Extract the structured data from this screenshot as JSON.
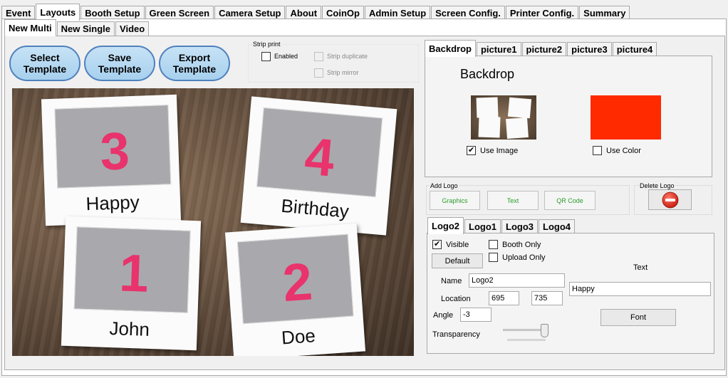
{
  "main_tabs": [
    "Event",
    "Layouts",
    "Booth Setup",
    "Green Screen",
    "Camera Setup",
    "About",
    "CoinOp",
    "Admin Setup",
    "Screen Config.",
    "Printer Config.",
    "Summary"
  ],
  "sub_tabs": [
    "New Multi",
    "New Single",
    "Video"
  ],
  "toolbar": {
    "select_template": "Select\nTemplate",
    "save_template": "Save\nTemplate",
    "export_template": "Export\nTemplate"
  },
  "strip_print": {
    "title": "Strip print",
    "enabled": "Enabled",
    "strip_duplicate": "Strip duplicate",
    "strip_mirror": "Strip mirror"
  },
  "template_preview": {
    "cards": [
      {
        "number": "3",
        "caption": "Happy"
      },
      {
        "number": "4",
        "caption": "Birthday"
      },
      {
        "number": "1",
        "caption": "John"
      },
      {
        "number": "2",
        "caption": "Doe"
      }
    ]
  },
  "backdrop_tabs": [
    "Backdrop",
    "picture1",
    "picture2",
    "picture3",
    "picture4"
  ],
  "backdrop": {
    "heading": "Backdrop",
    "use_image": "Use Image",
    "use_image_checked": true,
    "use_color": "Use Color",
    "use_color_checked": false,
    "color": "#ff2a00"
  },
  "add_logo": {
    "title": "Add Logo",
    "graphics": "Graphics",
    "text": "Text",
    "qr_code": "QR Code"
  },
  "delete_logo": {
    "title": "Delete Logo",
    "icon": "no-entry-icon"
  },
  "logo_tabs": [
    "Logo2",
    "Logo1",
    "Logo3",
    "Logo4"
  ],
  "logo": {
    "visible": "Visible",
    "visible_checked": true,
    "booth_only": "Booth Only",
    "upload_only": "Upload Only",
    "default_button": "Default",
    "name_label": "Name",
    "name_value": "Logo2",
    "location_label": "Location",
    "location_x": "695",
    "location_y": "735",
    "angle_label": "Angle",
    "angle_value": "-3",
    "transparency_label": "Transparency",
    "transparency_value": 1.0,
    "text_label": "Text",
    "text_value": "Happy",
    "font_button": "Font"
  }
}
